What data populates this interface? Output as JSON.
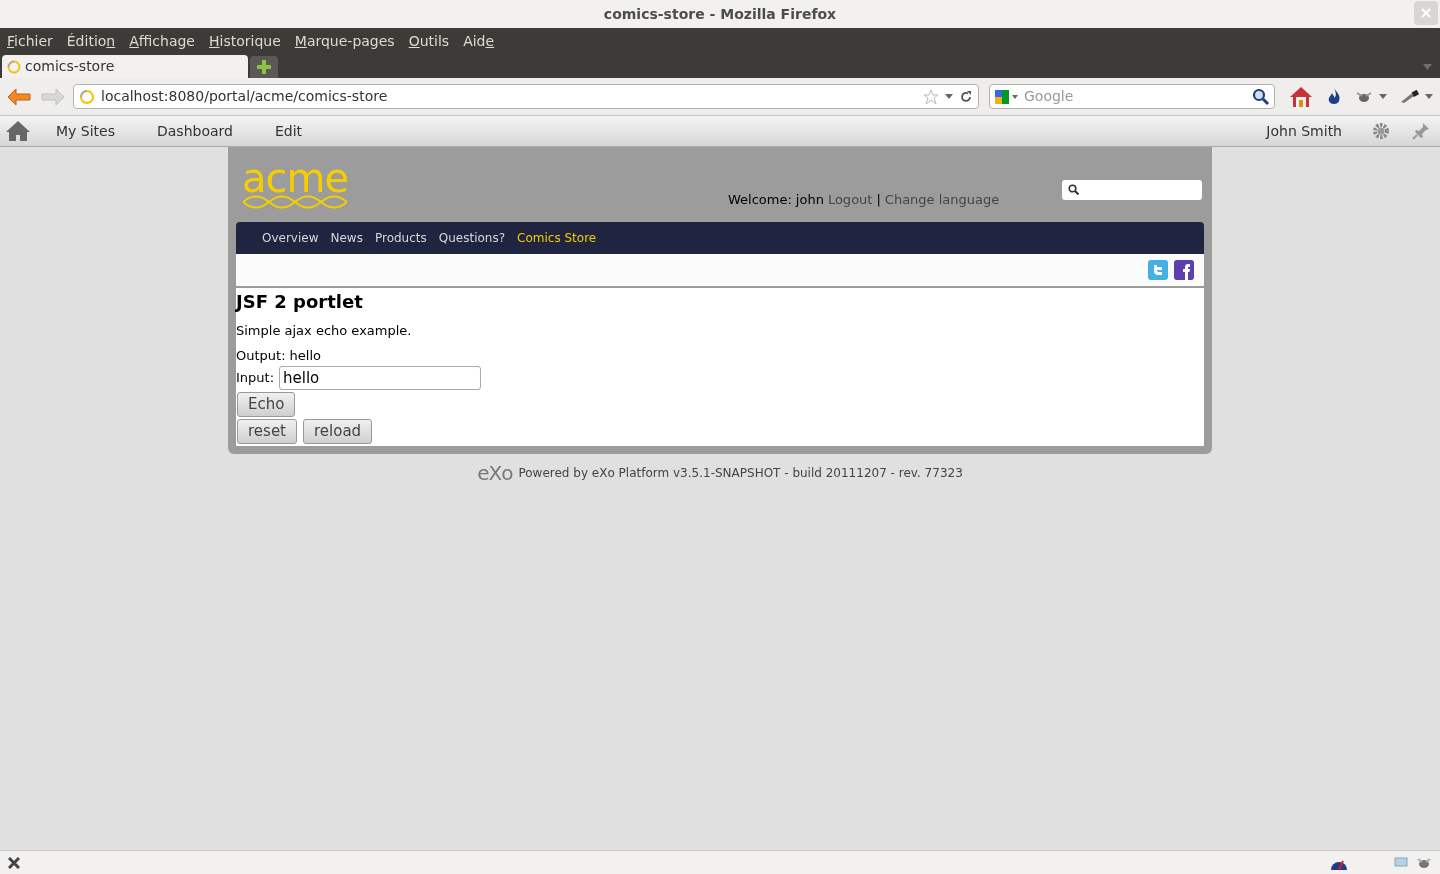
{
  "window": {
    "title": "comics-store - Mozilla Firefox"
  },
  "menu": [
    {
      "access_key": "F",
      "rest": "ichier"
    },
    {
      "start": "Éditio",
      "access_key": "n"
    },
    {
      "access_key": "A",
      "rest": "ffichage"
    },
    {
      "access_key": "H",
      "rest": "istorique"
    },
    {
      "access_key": "M",
      "rest": "arque-pages"
    },
    {
      "access_key": "O",
      "rest": "utils"
    },
    {
      "start": "Aid",
      "access_key": "e"
    }
  ],
  "tabs": [
    {
      "label": "comics-store",
      "selected": true
    }
  ],
  "address_bar": {
    "url": "localhost:8080/portal/acme/comics-store"
  },
  "search": {
    "placeholder": "Google"
  },
  "portal_toolbar": {
    "items": [
      "My Sites",
      "Dashboard",
      "Edit"
    ],
    "user": "John Smith"
  },
  "site": {
    "logo": "acme",
    "welcome_label": "Welcome:",
    "username": "john",
    "logout": "Logout",
    "separator": "|",
    "change_language": "Change language",
    "nav": [
      {
        "label": "Overview",
        "selected": false
      },
      {
        "label": "News",
        "selected": false
      },
      {
        "label": "Products",
        "selected": false
      },
      {
        "label": "Questions?",
        "selected": false
      },
      {
        "label": "Comics Store",
        "selected": true
      }
    ]
  },
  "portlet": {
    "title": "JSF 2 portlet",
    "description": "Simple ajax echo example.",
    "output_label": "Output:",
    "output_value": "hello",
    "input_label": "Input:",
    "input_value": "hello",
    "buttons": [
      [
        "Echo"
      ],
      [
        "reset",
        "reload"
      ]
    ]
  },
  "footer": {
    "logo": "eXo",
    "text": "Powered by eXo Platform v3.5.1-SNAPSHOT - build 20111207 - rev. 77323"
  }
}
